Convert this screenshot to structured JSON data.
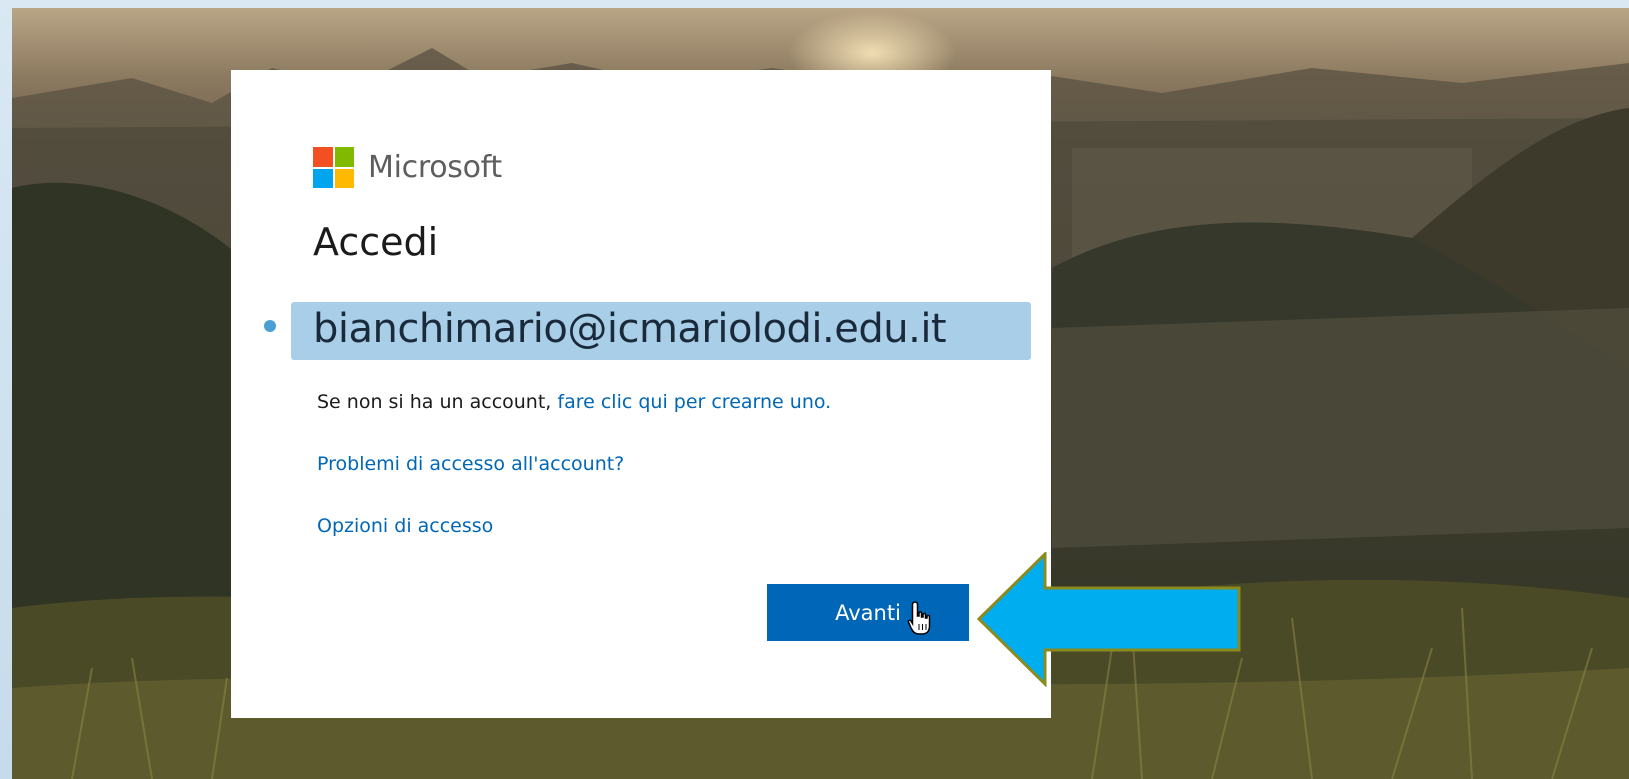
{
  "brand": {
    "name": "Microsoft",
    "logo_colors": [
      "#f25022",
      "#7fba00",
      "#00a4ef",
      "#ffb900"
    ]
  },
  "signin": {
    "title": "Accedi",
    "email_value": "bianchimario@icmariolodi.edu.it",
    "no_account_prefix": "Se non si ha un account, ",
    "create_account_link": "fare clic qui per crearne uno.",
    "trouble_link": "Problemi di accesso all'account?",
    "options_link": "Opzioni di accesso",
    "next_button": "Avanti"
  },
  "colors": {
    "accent": "#0067b8",
    "highlight": "#a9cfe8",
    "callout_arrow": "#00aeef",
    "callout_border": "#8a8a1e"
  }
}
